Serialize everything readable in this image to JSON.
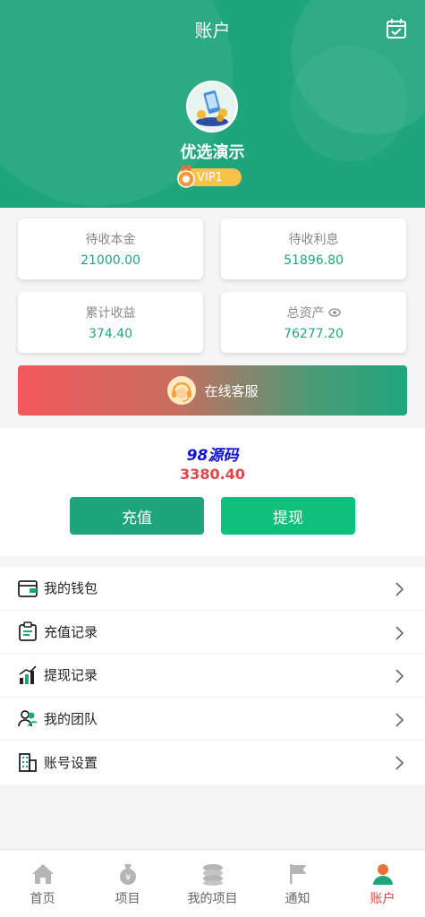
{
  "header": {
    "title": "账户",
    "username": "优选演示",
    "vip": "VIP1"
  },
  "stats": [
    {
      "label": "待收本金",
      "value": "21000.00"
    },
    {
      "label": "待收利息",
      "value": "51896.80"
    },
    {
      "label": "累计收益",
      "value": "374.40"
    },
    {
      "label": "总资产",
      "value": "76277.20"
    }
  ],
  "service": {
    "label": "在线客服"
  },
  "balance": {
    "watermark": "98源码",
    "amount": "3380.40",
    "recharge_label": "充值",
    "withdraw_label": "提现"
  },
  "menu": [
    {
      "label": "我的钱包",
      "icon": "wallet-icon"
    },
    {
      "label": "充值记录",
      "icon": "clipboard-icon"
    },
    {
      "label": "提现记录",
      "icon": "bar-chart-icon"
    },
    {
      "label": "我的团队",
      "icon": "team-icon"
    },
    {
      "label": "账号设置",
      "icon": "building-icon"
    }
  ],
  "tabs": [
    {
      "label": "首页",
      "icon": "home-icon"
    },
    {
      "label": "项目",
      "icon": "money-bag-icon"
    },
    {
      "label": "我的项目",
      "icon": "coin-stack-icon"
    },
    {
      "label": "通知",
      "icon": "flag-icon"
    },
    {
      "label": "账户",
      "icon": "user-icon"
    }
  ],
  "colors": {
    "primary": "#1fa57c",
    "accent_red": "#e0454a",
    "vip": "#f7c24a"
  }
}
